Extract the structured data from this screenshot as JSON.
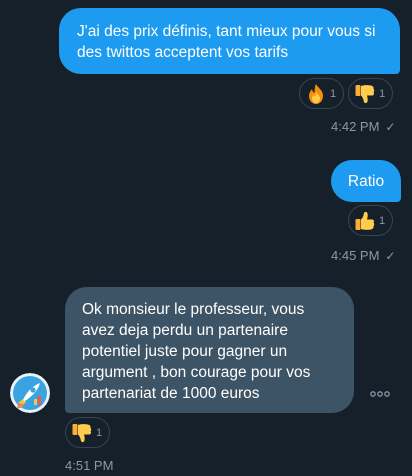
{
  "messages": [
    {
      "text": "J'ai des prix définis, tant mieux pour vous si des twittos acceptent vos tarifs",
      "direction": "sent",
      "reactions": [
        {
          "icon": "fire-emoji-icon",
          "count": "1"
        },
        {
          "icon": "thumbs-down-emoji-icon",
          "count": "1"
        }
      ],
      "time": "4:42 PM",
      "status_icon": "check-icon"
    },
    {
      "text": "Ratio",
      "direction": "sent",
      "reactions": [
        {
          "icon": "thumbs-up-emoji-icon",
          "count": "1"
        }
      ],
      "time": "4:45 PM",
      "status_icon": "check-icon"
    },
    {
      "text": "Ok monsieur le professeur, vous avez deja perdu un partenaire potentiel juste pour gagner un argument , bon courage pour vos partenariat de 1000 euros",
      "direction": "received",
      "reactions": [
        {
          "icon": "thumbs-down-emoji-icon",
          "count": "1"
        }
      ],
      "time": "4:51 PM",
      "sender_avatar": "rocket-avatar-icon",
      "more_icon": "more-options-icon"
    }
  ],
  "check_glyph": "✓",
  "colors": {
    "background": "#15202b",
    "sent_bubble": "#1d9bf0",
    "received_bubble": "#3d5466",
    "muted_text": "#8b98a5",
    "reaction_border": "#38444d"
  }
}
